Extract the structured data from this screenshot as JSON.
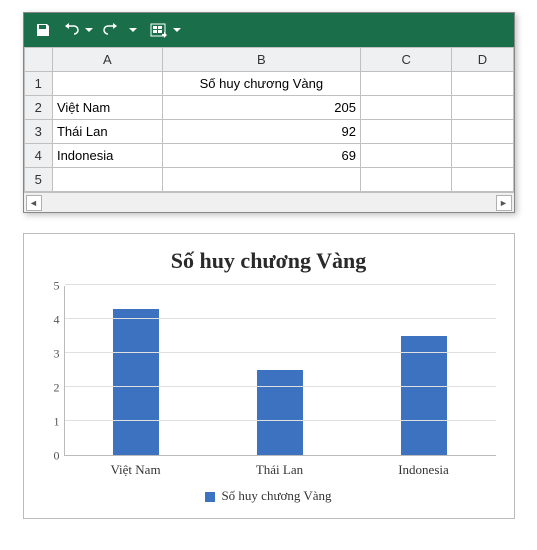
{
  "excel": {
    "columns": [
      "A",
      "B",
      "C",
      "D"
    ],
    "rows": [
      {
        "n": "1",
        "A": "",
        "B": "Số huy chương Vàng",
        "C": "",
        "D": ""
      },
      {
        "n": "2",
        "A": "Việt Nam",
        "B": "205",
        "C": "",
        "D": ""
      },
      {
        "n": "3",
        "A": "Thái Lan",
        "B": "92",
        "C": "",
        "D": ""
      },
      {
        "n": "4",
        "A": "Indonesia",
        "B": "69",
        "C": "",
        "D": ""
      },
      {
        "n": "5",
        "A": "",
        "B": "",
        "C": "",
        "D": ""
      }
    ]
  },
  "chart_data": {
    "type": "bar",
    "title": "Số huy chương Vàng",
    "categories": [
      "Việt Nam",
      "Thái Lan",
      "Indonesia"
    ],
    "values": [
      4.3,
      2.5,
      3.5
    ],
    "series_name": "Số huy chương Vàng",
    "yticks": [
      0,
      1,
      2,
      3,
      4,
      5
    ],
    "ylim": [
      0,
      5
    ],
    "xlabel": "",
    "ylabel": "",
    "bar_color": "#3d72c0"
  }
}
